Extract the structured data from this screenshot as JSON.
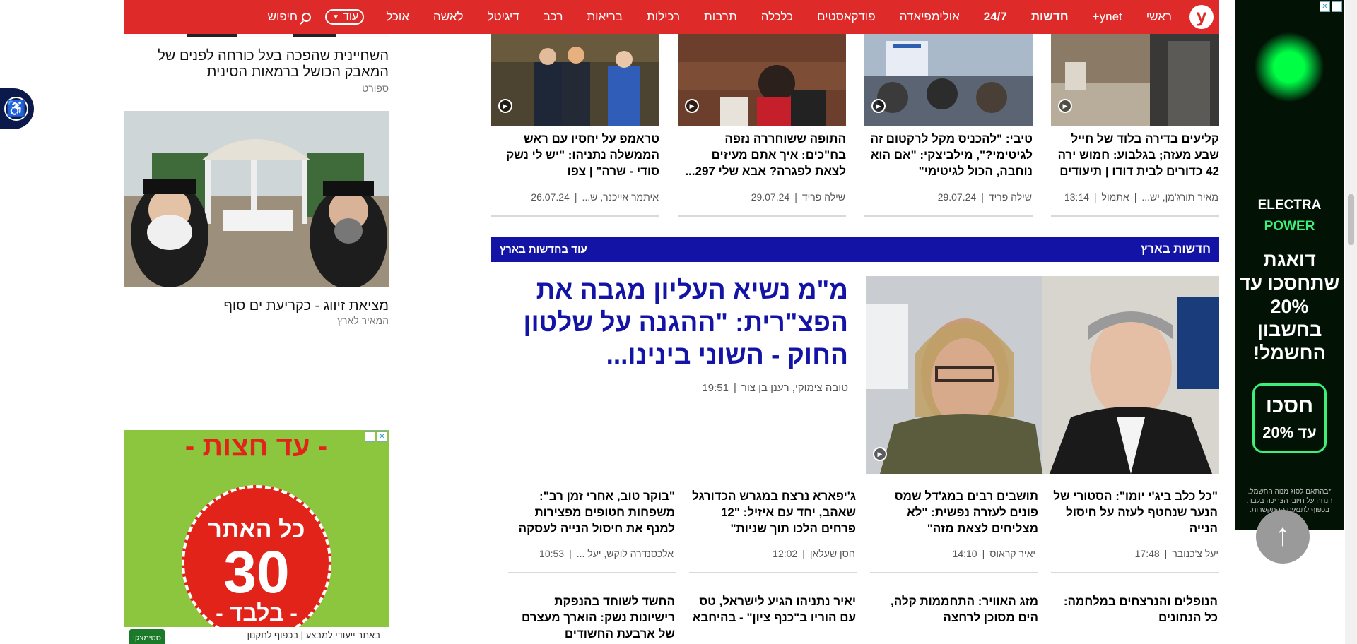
{
  "nav": {
    "logo": "y",
    "items": [
      "ראשי",
      "ynet+",
      "חדשות",
      "24/7",
      "אולימפיאדה",
      "פודקאסטים",
      "כלכלה",
      "תרבות",
      "רכילות",
      "בריאות",
      "רכב",
      "דיגיטל",
      "לאשה",
      "אוכל"
    ],
    "more_label": "עוד",
    "search_label": "חיפוש"
  },
  "sidebar": {
    "story1": {
      "title": "השחיינית שהפכה בעל כורחה לפנים של המאבק הכושל ברמאות הסינית",
      "category": "ספורט"
    },
    "story2": {
      "title": "מציאת זיווג - כקריעת ים סוף",
      "category": "המאיר לארץ"
    }
  },
  "top_cards": [
    {
      "title": "קליעים בדירה בלוד של חייל שבע מעזה; בגלבוע: חמוש ירה 42 כדורים לבית דודו | תיעודים",
      "author": "מאיר תורג'מן, יש...",
      "time": "אתמול",
      "date": "13:14"
    },
    {
      "title": "טיבי: \"להכניס מקל לרקטום זה לגיטימי?\", מילביצקי: \"אם הוא נוחבה, הכול לגיטימי\"",
      "author": "שילה פריד",
      "date": "29.07.24"
    },
    {
      "title": "התופה ששוחררה נזפה בח\"כים: איך אתם מעיזים לצאת לפגרה? אבא שלי 297...",
      "author": "שילה פריד",
      "date": "29.07.24"
    },
    {
      "title": "טראמפ על יחסיו עם ראש הממשלה נתניהו: \"יש לי נשק סודי - שרה\" | צפו",
      "author": "איתמר אייכנר, ש...",
      "date": "26.07.24"
    }
  ],
  "section": {
    "title": "חדשות בארץ",
    "more": "עוד בחדשות בארץ"
  },
  "main_story": {
    "headline": "מ\"מ נשיא העליון מגבה את הפצ\"רית: \"ההגנה על שלטון החוק - השוני בינינו...",
    "authors": "טובה צימוקי, רענן בן צור",
    "time": "19:51"
  },
  "row2": [
    {
      "title": "\"כל כלב ביג'י יומו\": הסטורי של הנער שנחטף לעזה על חיסול הנייה",
      "author": "יעל צ'כנובר",
      "time": "17:48"
    },
    {
      "title": "תושבים רבים במג'דל שמס פונים לעזרה נפשית: \"לא מצליחים לצאת מזה\"",
      "author": "יאיר קראוס",
      "time": "14:10"
    },
    {
      "title": "ג'יפארא נרצח במגרש הכדורגל שאהב, יחד עם איזיל: \"12 פרחים הלכו תוך שניות\"",
      "author": "חסן שעלאן",
      "time": "12:02"
    },
    {
      "title": "\"בוקר טוב, אחרי זמן רב\": משפחות חטופים מפצירות למנף את חיסול הנייה לעסקה",
      "author": "אלכסנדרה לוקש, יעל ...",
      "time": "10:53"
    }
  ],
  "row3": [
    {
      "title": "הנופלים והנרצחים במלחמה: כל הנתונים"
    },
    {
      "title": "מזג האוויר: התחממות קלה, הים מסוכן לרחצה"
    },
    {
      "title": "יאיר נתניהו הגיע לישראל, טס עם הוריו ב\"כנף ציון\" - בהיחבא"
    },
    {
      "title": "החשד לשוחד בהנפקת רישיונות נשק: הוארך מעצרם של ארבעת החשודים"
    }
  ],
  "right_ad": {
    "brand": "ELECTRA",
    "brand2": "POWER",
    "headline": "דואגת שתחסכו עד 20% בחשבון החשמל!",
    "cta_top": "חסכו",
    "cta_bottom": "עד 20%",
    "fine_print": "*בהתאם לסוג מנוה החשמל. הנחה על חיובי הצריכה בלבד. בכפוף לתנאים ההתקשרות."
  },
  "left_ad": {
    "banner": "- עד חצות -",
    "line1": "כל האתר",
    "line2": "30",
    "line3": "- בלבד -",
    "footer": "באתר ייעודי למבצע | בכפוף לתקנון",
    "logo": "סטימצקי"
  },
  "colors": {
    "nav_red": "#de2a28",
    "section_blue": "#1314a6"
  }
}
